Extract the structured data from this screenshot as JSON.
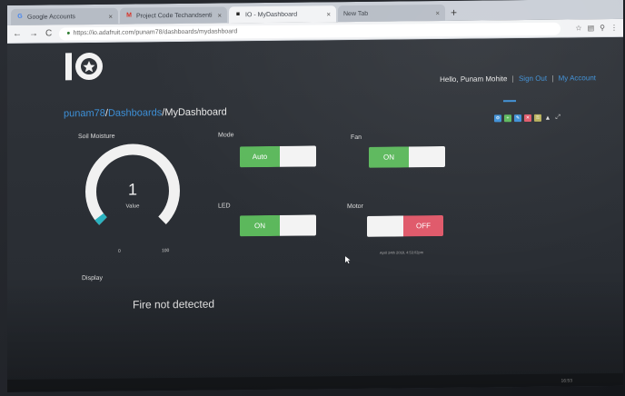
{
  "browser": {
    "tabs": [
      {
        "label": "Google Accounts",
        "icon": "G",
        "icon_color": "#4285f4"
      },
      {
        "label": "Project Code Techandsenti - pc",
        "icon": "M",
        "icon_color": "#d93025"
      },
      {
        "label": "IO - MyDashboard",
        "icon": "■",
        "icon_color": "#222222"
      },
      {
        "label": "New Tab",
        "icon": "",
        "icon_color": "#888888"
      }
    ],
    "url": "https://io.adafruit.com/punam78/dashboards/mydashboard"
  },
  "header": {
    "greeting": "Hello, Punam Mohite",
    "sign_out": "Sign Out",
    "my_account": "My Account"
  },
  "breadcrumb": {
    "user": "punam78",
    "dashboards": "Dashboards",
    "current": "MyDashboard"
  },
  "toolbar_colors": [
    "#3d8fd6",
    "#5cb85c",
    "#3d8fd6",
    "#e0596a",
    "#b8b05a"
  ],
  "blocks": {
    "soil": {
      "title": "Soil Moisture",
      "value": "1",
      "label": "Value",
      "min": "0",
      "max": "100",
      "fraction": 0.01
    },
    "mode": {
      "title": "Mode",
      "on_label": "Auto"
    },
    "fan": {
      "title": "Fan",
      "on_label": "ON"
    },
    "led": {
      "title": "LED",
      "on_label": "ON"
    },
    "motor": {
      "title": "Motor",
      "off_label": "OFF",
      "timestamp": "April 24th 2018, 4:53:02pm"
    },
    "display": {
      "title": "Display",
      "text": "Fire not detected"
    }
  },
  "clock": "16:53"
}
